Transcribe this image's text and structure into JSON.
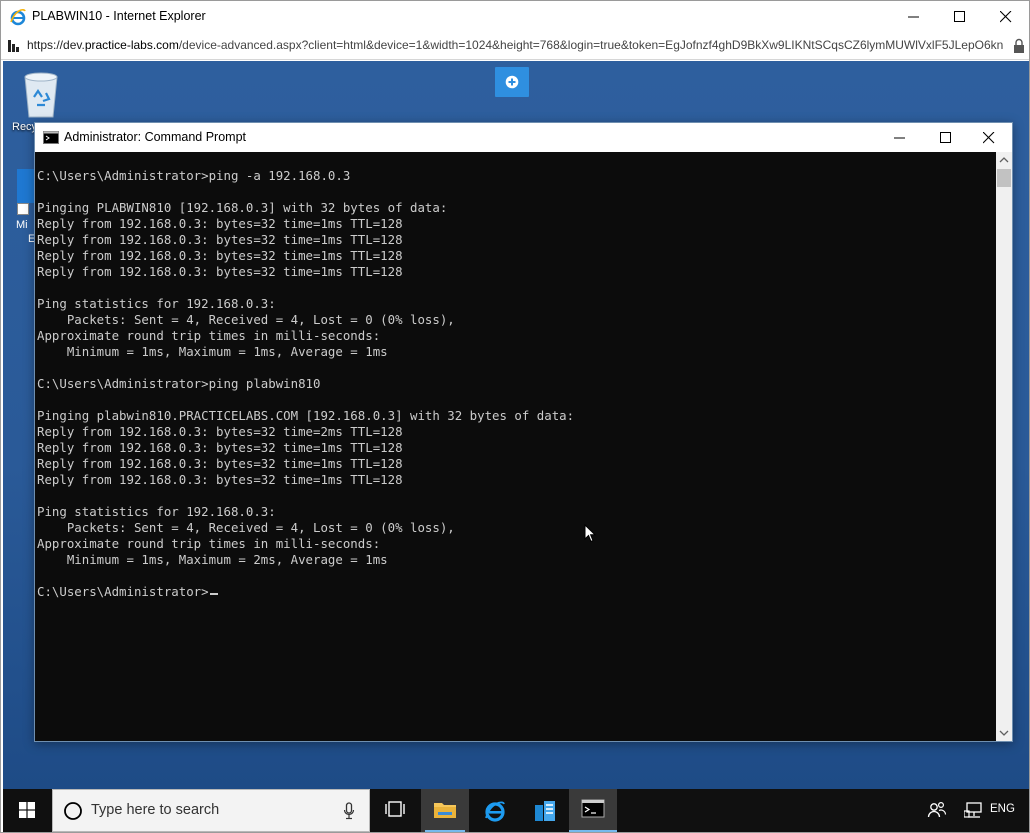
{
  "browser": {
    "title": "PLABWIN10 - Internet Explorer",
    "url_prefix": "https://dev.",
    "url_host": "practice-labs.com",
    "url_rest": "/device-advanced.aspx?client=html&device=1&width=1024&height=768&login=true&token=EgJofnzf4ghD9BkXw9LIKNtSCqsCZ6lymMUWlVxlF5JLepO6kn"
  },
  "desktop": {
    "recycle_bin_label": "Recy",
    "icon2_label_a": "Mi",
    "icon2_label_b": "E"
  },
  "cmd": {
    "title": "Administrator: Command Prompt",
    "lines": [
      "C:\\Users\\Administrator>ping -a 192.168.0.3",
      "",
      "Pinging PLABWIN810 [192.168.0.3] with 32 bytes of data:",
      "Reply from 192.168.0.3: bytes=32 time=1ms TTL=128",
      "Reply from 192.168.0.3: bytes=32 time=1ms TTL=128",
      "Reply from 192.168.0.3: bytes=32 time=1ms TTL=128",
      "Reply from 192.168.0.3: bytes=32 time=1ms TTL=128",
      "",
      "Ping statistics for 192.168.0.3:",
      "    Packets: Sent = 4, Received = 4, Lost = 0 (0% loss),",
      "Approximate round trip times in milli-seconds:",
      "    Minimum = 1ms, Maximum = 1ms, Average = 1ms",
      "",
      "C:\\Users\\Administrator>ping plabwin810",
      "",
      "Pinging plabwin810.PRACTICELABS.COM [192.168.0.3] with 32 bytes of data:",
      "Reply from 192.168.0.3: bytes=32 time=2ms TTL=128",
      "Reply from 192.168.0.3: bytes=32 time=1ms TTL=128",
      "Reply from 192.168.0.3: bytes=32 time=1ms TTL=128",
      "Reply from 192.168.0.3: bytes=32 time=1ms TTL=128",
      "",
      "Ping statistics for 192.168.0.3:",
      "    Packets: Sent = 4, Received = 4, Lost = 0 (0% loss),",
      "Approximate round trip times in milli-seconds:",
      "    Minimum = 1ms, Maximum = 2ms, Average = 1ms",
      "",
      "C:\\Users\\Administrator>"
    ]
  },
  "taskbar": {
    "search_placeholder": "Type here to search",
    "language": "ENG",
    "items": [
      "task-view",
      "file-explorer",
      "internet-explorer",
      "server-manager",
      "command-prompt"
    ]
  },
  "colors": {
    "desktop_blue": "#2b5b9a",
    "console_bg": "#0c0c0c",
    "console_fg": "#cccccc",
    "taskbar_bg": "#101010",
    "accent": "#76b9ed",
    "plus_button": "#2f8fe0"
  }
}
